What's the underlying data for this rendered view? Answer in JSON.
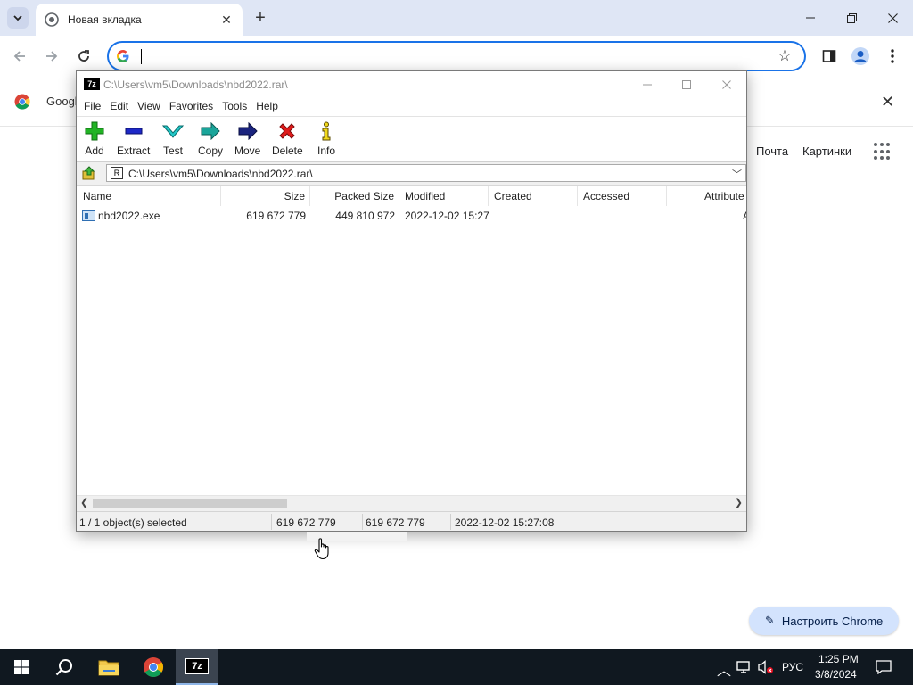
{
  "chrome": {
    "tab_title": "Новая вкладка",
    "omnibox_value": "",
    "bookmark_label": "Googl",
    "ntp_links": [
      "Почта",
      "Картинки"
    ],
    "customize_label": "Настроить Chrome"
  },
  "zip": {
    "title": "C:\\Users\\vm5\\Downloads\\nbd2022.rar\\",
    "app_icon": "7z",
    "menu": [
      "File",
      "Edit",
      "View",
      "Favorites",
      "Tools",
      "Help"
    ],
    "toolbar": [
      {
        "label": "Add",
        "icon": "plus-icon"
      },
      {
        "label": "Extract",
        "icon": "minus-icon"
      },
      {
        "label": "Test",
        "icon": "check-icon"
      },
      {
        "label": "Copy",
        "icon": "copy-arrow-icon"
      },
      {
        "label": "Move",
        "icon": "move-arrow-icon"
      },
      {
        "label": "Delete",
        "icon": "x-delete-icon"
      },
      {
        "label": "Info",
        "icon": "info-icon"
      }
    ],
    "address": "C:\\Users\\vm5\\Downloads\\nbd2022.rar\\",
    "columns": [
      "Name",
      "Size",
      "Packed Size",
      "Modified",
      "Created",
      "Accessed",
      "Attribute"
    ],
    "files": [
      {
        "name": "nbd2022.exe",
        "size": "619 672 779",
        "packed": "449 810 972",
        "modified": "2022-12-02 15:27",
        "created": "",
        "accessed": "",
        "attr": "A"
      }
    ],
    "status": {
      "selected": "1 / 1 object(s) selected",
      "size": "619 672 779",
      "packed": "619 672 779",
      "modified": "2022-12-02 15:27:08"
    }
  },
  "taskbar": {
    "lang": "РУС",
    "time": "1:25 PM",
    "date": "3/8/2024",
    "active_app": "7z"
  },
  "colors": {
    "chrome_accent": "#1a73e8",
    "tabstrip": "#dfe6f5",
    "taskbar": "#101820",
    "customize_bg": "#d3e3fd"
  }
}
